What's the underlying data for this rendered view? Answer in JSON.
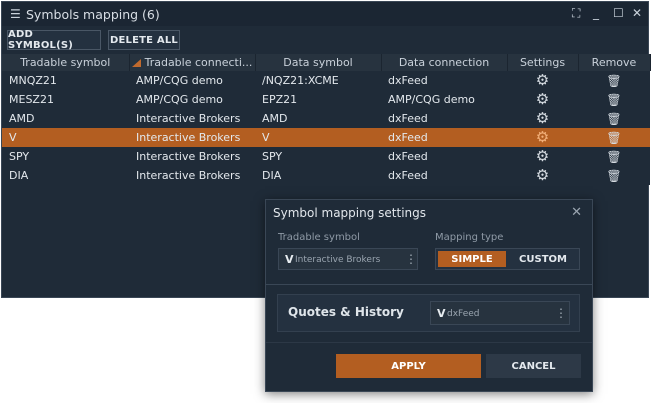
{
  "window": {
    "title": "Symbols mapping (6)",
    "menu_icon": "hamburger-icon",
    "controls": [
      "fullscreen-icon",
      "minimize-icon",
      "maximize-icon",
      "close-icon"
    ]
  },
  "toolbar": {
    "add_label": "ADD SYMBOL(S)",
    "delete_label": "DELETE ALL"
  },
  "table": {
    "headers": [
      "Tradable symbol",
      "Tradable connecti...",
      "Data symbol",
      "Data connection",
      "Settings",
      "Remove"
    ],
    "rows": [
      {
        "tradable": "MNQZ21",
        "tconn": "AMP/CQG demo",
        "dsym": "/NQZ21:XCME",
        "dconn": "dxFeed",
        "selected": false
      },
      {
        "tradable": "MESZ21",
        "tconn": "AMP/CQG demo",
        "dsym": "EPZ21",
        "dconn": "AMP/CQG demo",
        "selected": false
      },
      {
        "tradable": "AMD",
        "tconn": "Interactive Brokers",
        "dsym": "AMD",
        "dconn": "dxFeed",
        "selected": false
      },
      {
        "tradable": "V",
        "tconn": "Interactive Brokers",
        "dsym": "V",
        "dconn": "dxFeed",
        "selected": true
      },
      {
        "tradable": "SPY",
        "tconn": "Interactive Brokers",
        "dsym": "SPY",
        "dconn": "dxFeed",
        "selected": false
      },
      {
        "tradable": "DIA",
        "tconn": "Interactive Brokers",
        "dsym": "DIA",
        "dconn": "dxFeed",
        "selected": false
      }
    ]
  },
  "dialog": {
    "title": "Symbol mapping settings",
    "tradable_label": "Tradable symbol",
    "tradable_value": "V",
    "tradable_conn": "Interactive Brokers",
    "mapping_label": "Mapping type",
    "simple_label": "SIMPLE",
    "custom_label": "CUSTOM",
    "quotes_label": "Quotes & History",
    "data_value": "V",
    "data_conn": "dxFeed",
    "apply_label": "APPLY",
    "cancel_label": "CANCEL"
  },
  "colors": {
    "accent": "#b35e21",
    "panel": "#1f2b38",
    "header": "#27333f"
  }
}
